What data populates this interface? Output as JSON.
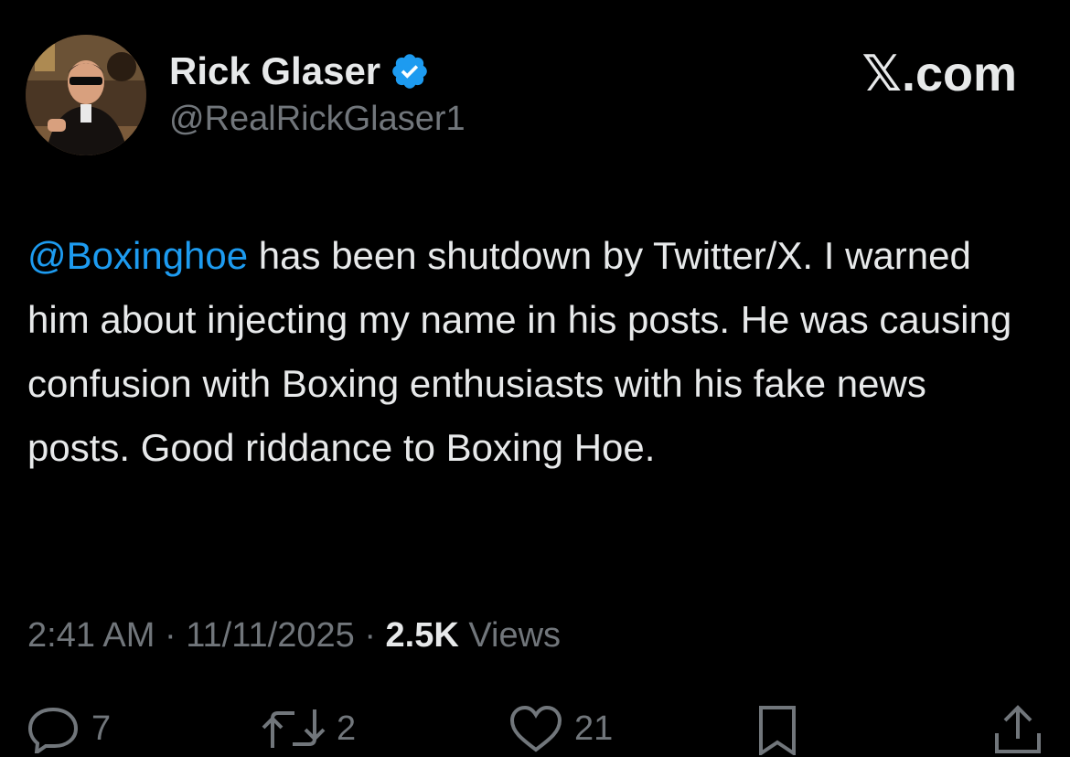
{
  "author": {
    "display_name": "Rick Glaser",
    "handle": "@RealRickGlaser1",
    "verified": true,
    "avatar": "profile-photo"
  },
  "brand": "𝕏.com",
  "tweet": {
    "mention": "@Boxinghoe",
    "text": " has been shutdown by Twitter/X. I warned him about injecting my name in his posts. He was causing confusion with Boxing enthusiasts with his fake news posts. Good riddance to Boxing Hoe."
  },
  "meta": {
    "time": "2:41 AM",
    "separator": "·",
    "date": "11/11/2025",
    "views_count": "2.5K",
    "views_label": "Views"
  },
  "actions": {
    "replies": "7",
    "reposts": "2",
    "likes": "21"
  },
  "colors": {
    "background": "#000000",
    "text": "#e7e9ea",
    "secondary": "#71767b",
    "accent": "#1d9bf0"
  }
}
